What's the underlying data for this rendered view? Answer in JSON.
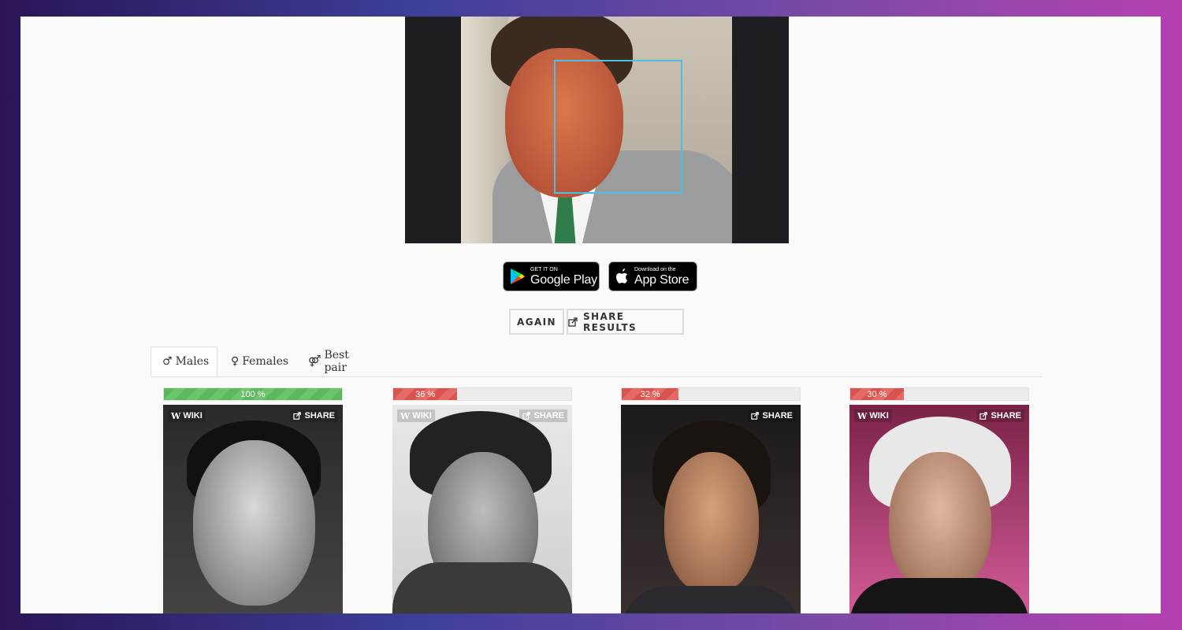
{
  "badges": {
    "google": {
      "small": "GET IT ON",
      "big": "Google Play"
    },
    "apple": {
      "small": "Download on the",
      "big": "App Store"
    }
  },
  "actions": {
    "again": "AGAIN",
    "share": "SHARE RESULTS"
  },
  "tabs": [
    {
      "label": "Males",
      "icon": "♂"
    },
    {
      "label": "Females",
      "icon": "♀"
    },
    {
      "label": "Best pair",
      "icon": "⚤"
    }
  ],
  "cards": [
    {
      "percent_label": "100 %",
      "percent": 100,
      "bar_color": "#5cb85c",
      "wiki": "WIKI",
      "share": "SHARE"
    },
    {
      "percent_label": "36 %",
      "percent": 36,
      "bar_color": "#d9534f",
      "wiki": "WIKI",
      "share": "SHARE"
    },
    {
      "percent_label": "32 %",
      "percent": 32,
      "bar_color": "#d9534f",
      "share": "SHARE"
    },
    {
      "percent_label": "30 %",
      "percent": 30,
      "bar_color": "#d9534f",
      "wiki": "WIKI",
      "share": "SHARE"
    }
  ],
  "colors": {
    "face_box": "#4cc0e4",
    "match_high": "#5cb85c",
    "match_low": "#d9534f"
  }
}
